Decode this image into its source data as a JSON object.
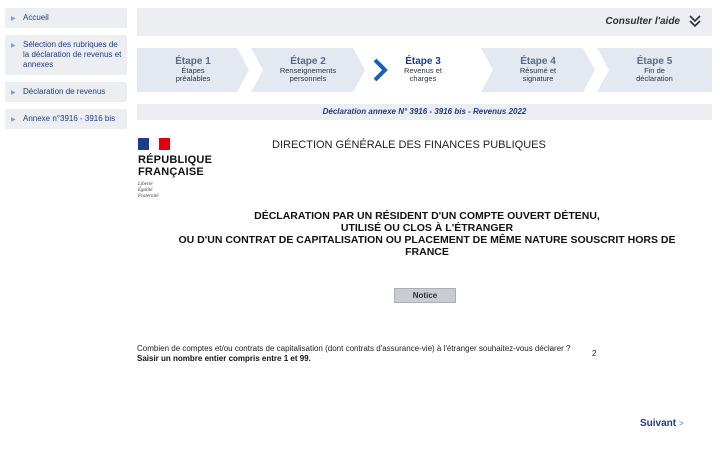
{
  "sidebar": {
    "items": [
      {
        "label": "Accueil"
      },
      {
        "label": "Sélection des rubriques de la déclaration de revenus et annexes"
      },
      {
        "label": "Déclaration de revenus"
      },
      {
        "label": "Annexe n°3916 - 3916 bis"
      }
    ]
  },
  "header": {
    "help_label": "Consulter l'aide"
  },
  "steps": [
    {
      "title": "Étape 1",
      "desc": "Étapes préalables"
    },
    {
      "title": "Étape 2",
      "desc": "Renseignements personnels"
    },
    {
      "title": "Étape 3",
      "desc": "Revenus et charges",
      "active": true
    },
    {
      "title": "Étape 4",
      "desc": "Résumé et signature"
    },
    {
      "title": "Étape 5",
      "desc": "Fin de déclaration"
    }
  ],
  "declaration_label": "Déclaration annexe N° 3916 - 3916 bis - Revenus 2022",
  "logo": {
    "line1": "RÉPUBLIQUE",
    "line2": "FRANÇAISE",
    "motto": [
      "Liberté",
      "Égalité",
      "Fraternité"
    ]
  },
  "dgfip": "DIRECTION GÉNÉRALE DES FINANCES PUBLIQUES",
  "form_title": [
    "DÉCLARATION PAR UN RÉSIDENT D'UN COMPTE OUVERT DÉTENU,",
    "UTILISÉ OU CLOS À L'ÉTRANGER",
    "OU D'UN CONTRAT DE CAPITALISATION OU PLACEMENT DE MÊME NATURE SOUSCRIT HORS DE",
    "FRANCE"
  ],
  "notice_label": "Notice",
  "question": {
    "text": "Combien de comptes et/ou contrats de capitalisation (dont contrats d'assurance-vie) à l'étranger souhaitez-vous déclarer ? ",
    "hint": "Saisir un nombre entier compris entre 1 et 99.",
    "value": "2"
  },
  "next_label": "Suivant",
  "colors": {
    "accent": "#1b3d8a",
    "panel": "#eceef1",
    "flag_blue": "#1b3d8a",
    "flag_red": "#e1000f"
  }
}
